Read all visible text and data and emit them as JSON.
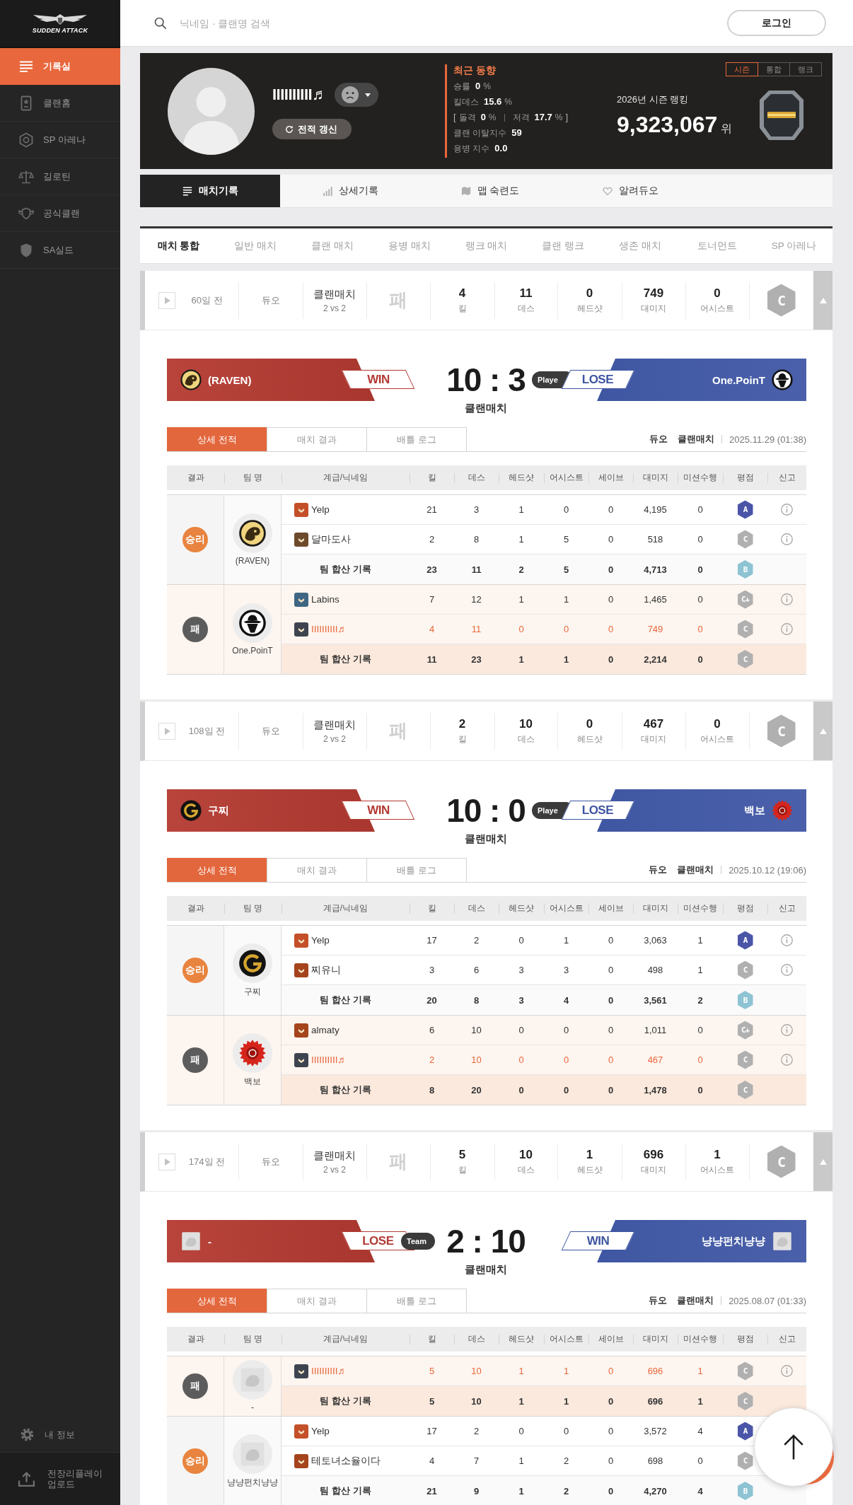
{
  "sidebar": {
    "logo": "SUDDEN ATTACK",
    "items": [
      {
        "label": "기록실",
        "selected": true
      },
      {
        "label": "클랜홈",
        "selected": false
      },
      {
        "label": "SP 아레나",
        "selected": false
      },
      {
        "label": "길로틴",
        "selected": false
      },
      {
        "label": "공식클랜",
        "selected": false
      },
      {
        "label": "SA실드",
        "selected": false
      }
    ],
    "footer": [
      {
        "label": "내 정보"
      },
      {
        "label": "전장리플레이 업로드"
      }
    ]
  },
  "header": {
    "search": {
      "placeholder": "닉네임 · 클랜명 검색"
    },
    "login_button": "로그인"
  },
  "profile": {
    "name": "IIIIIIIIII♬",
    "refresh_button": "전적 갱신",
    "recent": {
      "title": "최근 동향",
      "lines": [
        {
          "items": [
            {
              "label": "승률",
              "value": "0",
              "unit": "%"
            }
          ]
        },
        {
          "items": [
            {
              "label": "킬데스",
              "value": "15.6",
              "unit": "%"
            }
          ]
        },
        {
          "open": "[",
          "close": "]",
          "items": [
            {
              "label": "돌격",
              "value": "0",
              "unit": "%"
            },
            {
              "label": "저격",
              "value": "17.7",
              "unit": "%"
            }
          ]
        },
        {
          "items": [
            {
              "label": "클랜 이탈지수",
              "value": "59"
            }
          ]
        },
        {
          "items": [
            {
              "label": "용병 지수",
              "value": "0.0"
            }
          ]
        }
      ]
    },
    "ranking": {
      "tabs": [
        {
          "label": "시즌",
          "selected": true
        },
        {
          "label": "통합",
          "selected": false
        },
        {
          "label": "랭크",
          "selected": false
        }
      ],
      "title": "2026년 시즌 랭킹",
      "value": "9,323,067",
      "unit": "위"
    }
  },
  "tabs": [
    {
      "label": "매치기록",
      "selected": true
    },
    {
      "label": "상세기록",
      "selected": false
    },
    {
      "label": "맵 숙련도",
      "selected": false
    },
    {
      "label": "알려듀오",
      "selected": false
    }
  ],
  "mode_filters": [
    {
      "label": "매치 통합",
      "selected": true
    },
    {
      "label": "일반 매치",
      "selected": false
    },
    {
      "label": "클랜 매치",
      "selected": false
    },
    {
      "label": "용병 매치",
      "selected": false
    },
    {
      "label": "랭크 매치",
      "selected": false
    },
    {
      "label": "클랜 랭크",
      "selected": false
    },
    {
      "label": "생존 매치",
      "selected": false
    },
    {
      "label": "토너먼트",
      "selected": false
    },
    {
      "label": "SP 아레나",
      "selected": false
    }
  ],
  "matches": [
    {
      "expanded": true,
      "summary": {
        "ago": "60일 전",
        "party": "듀오",
        "mode": "클랜매치",
        "format": "2 vs 2",
        "result": "패",
        "stats": [
          {
            "value": "4",
            "label": "킬"
          },
          {
            "value": "11",
            "label": "데스"
          },
          {
            "value": "0",
            "label": "헤드샷"
          },
          {
            "value": "749",
            "label": "대미지"
          },
          {
            "value": "0",
            "label": "어시스트"
          }
        ],
        "grade": {
          "label": "C",
          "color": "#b0b0b0"
        }
      },
      "scoreboard": {
        "teams": [
          {
            "name": "(RAVEN)",
            "result": "WIN"
          },
          {
            "name": "One.PoinT",
            "result": "LOSE",
            "tag": "Playe"
          }
        ],
        "score": "10 : 3",
        "mode": "클랜매치"
      },
      "tabs": [
        {
          "label": "상세 전적",
          "selected": true
        },
        {
          "label": "매치 결과",
          "selected": false
        },
        {
          "label": "배틀 로그",
          "selected": false
        }
      ],
      "meta": {
        "party": "듀오",
        "mode": "클랜매치",
        "date": "2025.11.29 (01:38)"
      },
      "table": {
        "columns": [
          "결과",
          "팀 명",
          "계급/닉네임",
          "킬",
          "데스",
          "헤드샷",
          "어시스트",
          "세이브",
          "대미지",
          "미션수행",
          "평점",
          "신고"
        ],
        "teams": [
          {
            "won": true,
            "result": "승리",
            "name": "(RAVEN)",
            "players": [
              {
                "name": "Yelp",
                "color": "#c4502a",
                "highlighted": false,
                "report": true,
                "stats": [
                  "21",
                  "3",
                  "1",
                  "0",
                  "0",
                  "4,195",
                  "0"
                ],
                "grade": {
                  "label": "A",
                  "color": "#4a55a8"
                }
              },
              {
                "name": "달마도사",
                "color": "#6e4a2c",
                "highlighted": false,
                "report": true,
                "stats": [
                  "2",
                  "8",
                  "1",
                  "5",
                  "0",
                  "518",
                  "0"
                ],
                "grade": {
                  "label": "C",
                  "color": "#b0b0b0"
                }
              }
            ],
            "total": {
              "label": "팀 합산 기록",
              "stats": [
                "23",
                "11",
                "2",
                "5",
                "0",
                "4,713",
                "0"
              ],
              "grade": {
                "label": "B",
                "color": "#8dc3d3"
              }
            }
          },
          {
            "won": false,
            "result": "패",
            "name": "One.PoinT",
            "players": [
              {
                "name": "Labins",
                "color": "#3f6784",
                "highlighted": false,
                "report": true,
                "stats": [
                  "7",
                  "12",
                  "1",
                  "1",
                  "0",
                  "1,465",
                  "0"
                ],
                "grade": {
                  "label": "C+",
                  "color": "#b0b0b0"
                }
              },
              {
                "name": "IIIIIIIIII♬",
                "color": "#3d4450",
                "highlighted": true,
                "report": true,
                "stats": [
                  "4",
                  "11",
                  "0",
                  "0",
                  "0",
                  "749",
                  "0"
                ],
                "grade": {
                  "label": "C",
                  "color": "#b0b0b0"
                }
              }
            ],
            "total": {
              "label": "팀 합산 기록",
              "stats": [
                "11",
                "23",
                "1",
                "1",
                "0",
                "2,214",
                "0"
              ],
              "grade": {
                "label": "C",
                "color": "#b0b0b0"
              }
            }
          }
        ]
      }
    },
    {
      "expanded": true,
      "summary": {
        "ago": "108일 전",
        "party": "듀오",
        "mode": "클랜매치",
        "format": "2 vs 2",
        "result": "패",
        "stats": [
          {
            "value": "2",
            "label": "킬"
          },
          {
            "value": "10",
            "label": "데스"
          },
          {
            "value": "0",
            "label": "헤드샷"
          },
          {
            "value": "467",
            "label": "대미지"
          },
          {
            "value": "0",
            "label": "어시스트"
          }
        ],
        "grade": {
          "label": "C",
          "color": "#b0b0b0"
        }
      },
      "scoreboard": {
        "teams": [
          {
            "name": "구찌",
            "result": "WIN"
          },
          {
            "name": "백보",
            "result": "LOSE",
            "tag": "Playe"
          }
        ],
        "score": "10 : 0",
        "mode": "클랜매치"
      },
      "tabs": [
        {
          "label": "상세 전적",
          "selected": true
        },
        {
          "label": "매치 결과",
          "selected": false
        },
        {
          "label": "배틀 로그",
          "selected": false
        }
      ],
      "meta": {
        "party": "듀오",
        "mode": "클랜매치",
        "date": "2025.10.12 (19:06)"
      },
      "table": {
        "columns": [
          "결과",
          "팀 명",
          "계급/닉네임",
          "킬",
          "데스",
          "헤드샷",
          "어시스트",
          "세이브",
          "대미지",
          "미션수행",
          "평점",
          "신고"
        ],
        "teams": [
          {
            "won": true,
            "result": "승리",
            "name": "구찌",
            "players": [
              {
                "name": "Yelp",
                "color": "#c4502a",
                "highlighted": false,
                "report": true,
                "stats": [
                  "17",
                  "2",
                  "0",
                  "1",
                  "0",
                  "3,063",
                  "1"
                ],
                "grade": {
                  "label": "A",
                  "color": "#4a55a8"
                }
              },
              {
                "name": "찌유니",
                "color": "#a5441c",
                "highlighted": false,
                "report": true,
                "stats": [
                  "3",
                  "6",
                  "3",
                  "3",
                  "0",
                  "498",
                  "1"
                ],
                "grade": {
                  "label": "C",
                  "color": "#b0b0b0"
                }
              }
            ],
            "total": {
              "label": "팀 합산 기록",
              "stats": [
                "20",
                "8",
                "3",
                "4",
                "0",
                "3,561",
                "2"
              ],
              "grade": {
                "label": "B",
                "color": "#8dc3d3"
              }
            }
          },
          {
            "won": false,
            "result": "패",
            "name": "백보",
            "players": [
              {
                "name": "almaty",
                "color": "#a5441c",
                "highlighted": false,
                "report": true,
                "stats": [
                  "6",
                  "10",
                  "0",
                  "0",
                  "0",
                  "1,011",
                  "0"
                ],
                "grade": {
                  "label": "C+",
                  "color": "#b0b0b0"
                }
              },
              {
                "name": "IIIIIIIIII♬",
                "color": "#3d4450",
                "highlighted": true,
                "report": true,
                "stats": [
                  "2",
                  "10",
                  "0",
                  "0",
                  "0",
                  "467",
                  "0"
                ],
                "grade": {
                  "label": "C",
                  "color": "#b0b0b0"
                }
              }
            ],
            "total": {
              "label": "팀 합산 기록",
              "stats": [
                "8",
                "20",
                "0",
                "0",
                "0",
                "1,478",
                "0"
              ],
              "grade": {
                "label": "C",
                "color": "#b0b0b0"
              }
            }
          }
        ]
      }
    },
    {
      "expanded": true,
      "summary": {
        "ago": "174일 전",
        "party": "듀오",
        "mode": "클랜매치",
        "format": "2 vs 2",
        "result": "패",
        "stats": [
          {
            "value": "5",
            "label": "킬"
          },
          {
            "value": "10",
            "label": "데스"
          },
          {
            "value": "1",
            "label": "헤드샷"
          },
          {
            "value": "696",
            "label": "대미지"
          },
          {
            "value": "1",
            "label": "어시스트"
          }
        ],
        "grade": {
          "label": "C",
          "color": "#b0b0b0"
        }
      },
      "scoreboard": {
        "teams": [
          {
            "name": "-",
            "result": "LOSE",
            "tag": "Team"
          },
          {
            "name": "냥냥펀치냥냥",
            "result": "WIN"
          }
        ],
        "score": "2 : 10",
        "mode": "클랜매치"
      },
      "tabs": [
        {
          "label": "상세 전적",
          "selected": true
        },
        {
          "label": "매치 결과",
          "selected": false
        },
        {
          "label": "배틀 로그",
          "selected": false
        }
      ],
      "meta": {
        "party": "듀오",
        "mode": "클랜매치",
        "date": "2025.08.07 (01:33)"
      },
      "table": {
        "columns": [
          "결과",
          "팀 명",
          "계급/닉네임",
          "킬",
          "데스",
          "헤드샷",
          "어시스트",
          "세이브",
          "대미지",
          "미션수행",
          "평점",
          "신고"
        ],
        "teams": [
          {
            "won": false,
            "result": "패",
            "name": "-",
            "players": [
              {
                "name": "IIIIIIIIII♬",
                "color": "#3d4450",
                "highlighted": true,
                "report": true,
                "stats": [
                  "5",
                  "10",
                  "1",
                  "1",
                  "0",
                  "696",
                  "1"
                ],
                "grade": {
                  "label": "C",
                  "color": "#b0b0b0"
                }
              }
            ],
            "total": {
              "label": "팀 합산 기록",
              "stats": [
                "5",
                "10",
                "1",
                "1",
                "0",
                "696",
                "1"
              ],
              "grade": {
                "label": "C",
                "color": "#b0b0b0"
              }
            }
          },
          {
            "won": true,
            "result": "승리",
            "name": "냥냥펀치냥냥",
            "players": [
              {
                "name": "Yelp",
                "color": "#c4502a",
                "highlighted": false,
                "report": false,
                "stats": [
                  "17",
                  "2",
                  "0",
                  "0",
                  "0",
                  "3,572",
                  "4"
                ],
                "grade": {
                  "label": "A",
                  "color": "#4a55a8"
                }
              },
              {
                "name": "테토녀소율이다",
                "color": "#a5441c",
                "highlighted": false,
                "report": false,
                "stats": [
                  "4",
                  "7",
                  "1",
                  "2",
                  "0",
                  "698",
                  "0"
                ],
                "grade": {
                  "label": "C",
                  "color": "#b0b0b0"
                }
              }
            ],
            "total": {
              "label": "팀 합산 기록",
              "stats": [
                "21",
                "9",
                "1",
                "2",
                "0",
                "4,270",
                "4"
              ],
              "grade": {
                "label": "B",
                "color": "#8dc3d3"
              }
            }
          }
        ]
      }
    }
  ]
}
